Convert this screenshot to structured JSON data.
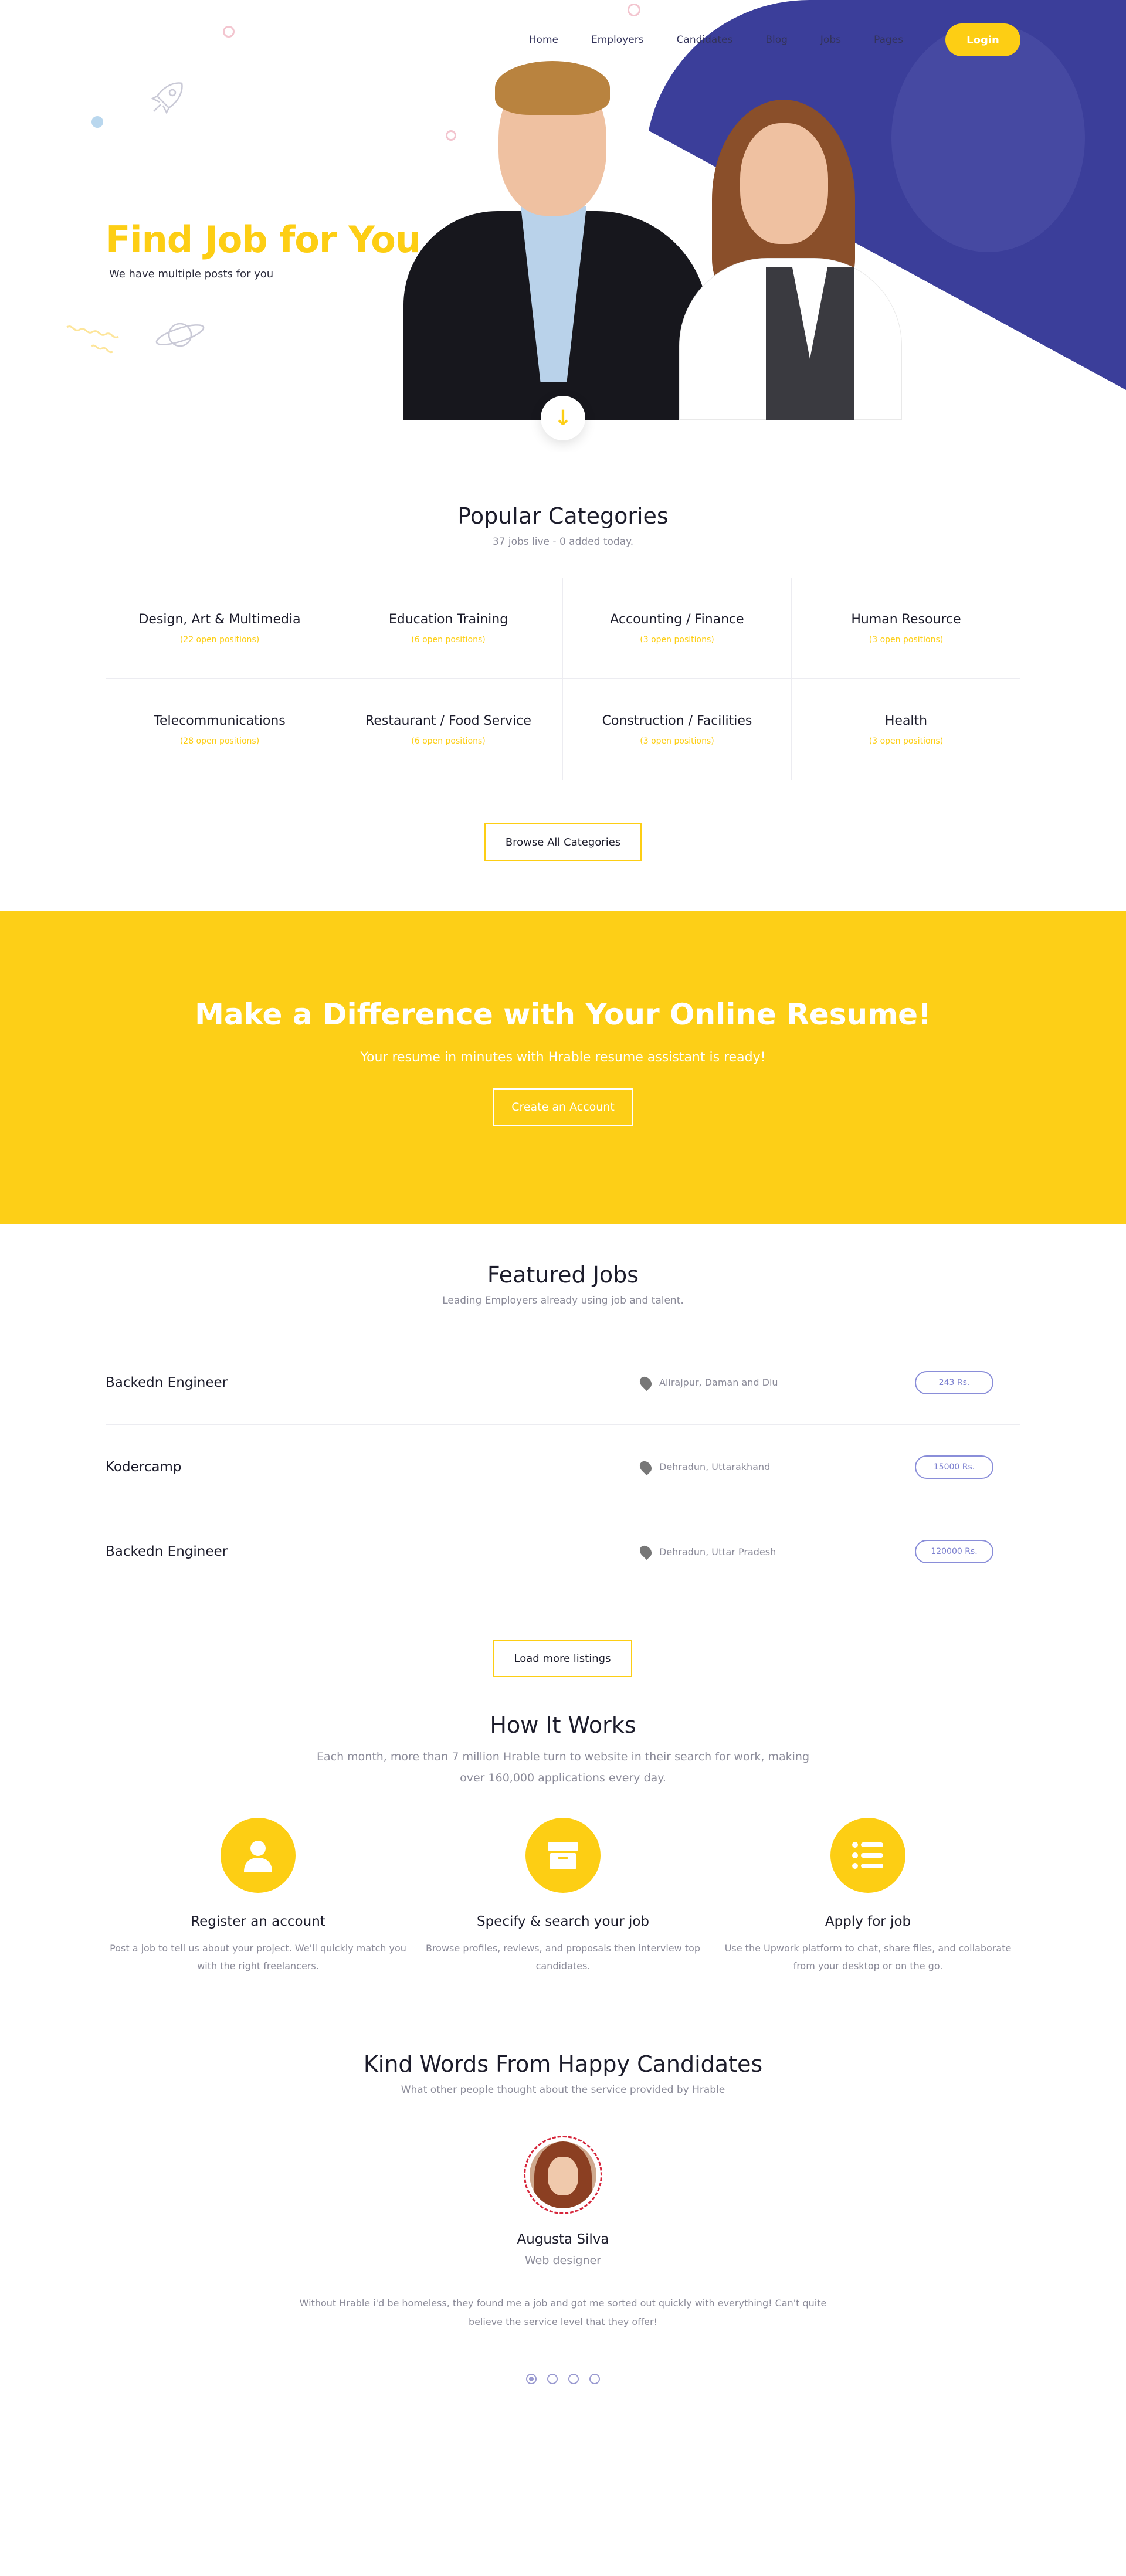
{
  "nav": {
    "links": [
      "Home",
      "Employers",
      "Candidates",
      "Blog",
      "Jobs",
      "Pages"
    ],
    "login_label": "Login"
  },
  "hero": {
    "title": "Find Job for You",
    "subtitle": "We have multiple posts for you"
  },
  "categories": {
    "title": "Popular Categories",
    "subtitle": "37 jobs live - 0 added today.",
    "items": [
      {
        "name": "Design, Art & Multimedia",
        "count": "(22 open positions)"
      },
      {
        "name": "Education Training",
        "count": "(6 open positions)"
      },
      {
        "name": "Accounting / Finance",
        "count": "(3 open positions)"
      },
      {
        "name": "Human Resource",
        "count": "(3 open positions)"
      },
      {
        "name": "Telecommunications",
        "count": "(28 open positions)"
      },
      {
        "name": "Restaurant / Food Service",
        "count": "(6 open positions)"
      },
      {
        "name": "Construction / Facilities",
        "count": "(3 open positions)"
      },
      {
        "name": "Health",
        "count": "(3 open positions)"
      }
    ],
    "browse_label": "Browse All Categories"
  },
  "banner": {
    "title": "Make a Difference with Your Online Resume!",
    "subtitle": "Your resume in minutes with Hrable resume assistant is ready!",
    "button_label": "Create an Account"
  },
  "featured": {
    "title": "Featured Jobs",
    "subtitle": "Leading Employers already using job and talent.",
    "jobs": [
      {
        "title": "Backedn Engineer",
        "location": "Alirajpur, Daman and Diu",
        "salary": "243 Rs."
      },
      {
        "title": "Kodercamp",
        "location": "Dehradun, Uttarakhand",
        "salary": "15000 Rs."
      },
      {
        "title": "Backedn Engineer",
        "location": "Dehradun, Uttar Pradesh",
        "salary": "120000 Rs."
      }
    ],
    "load_more_label": "Load more listings"
  },
  "how": {
    "title": "How It Works",
    "subtitle": "Each month, more than 7 million Hrable turn to website in their search for work, making over 160,000 applications every day.",
    "steps": [
      {
        "icon": "user-icon",
        "title": "Register an account",
        "text": "Post a job to tell us about your project. We'll quickly match you with the right freelancers."
      },
      {
        "icon": "archive-icon",
        "title": "Specify & search your job",
        "text": "Browse profiles, reviews, and proposals then interview top candidates."
      },
      {
        "icon": "list-icon",
        "title": "Apply for job",
        "text": "Use the Upwork platform to chat, share files, and collaborate from your desktop or on the go."
      }
    ]
  },
  "testimonials": {
    "title": "Kind Words From Happy Candidates",
    "subtitle": "What other people thought about the service provided by Hrable",
    "name": "Augusta Silva",
    "role": "Web designer",
    "quote": "Without Hrable i'd be homeless, they found me a job and got me sorted out quickly with everything! Can't quite believe the service level that they offer!",
    "slide_count": 4,
    "active_slide": 1
  },
  "colors": {
    "accent": "#fdce14",
    "hero_blue": "#3b3e9a",
    "salary_outline": "#8a8ed9"
  }
}
